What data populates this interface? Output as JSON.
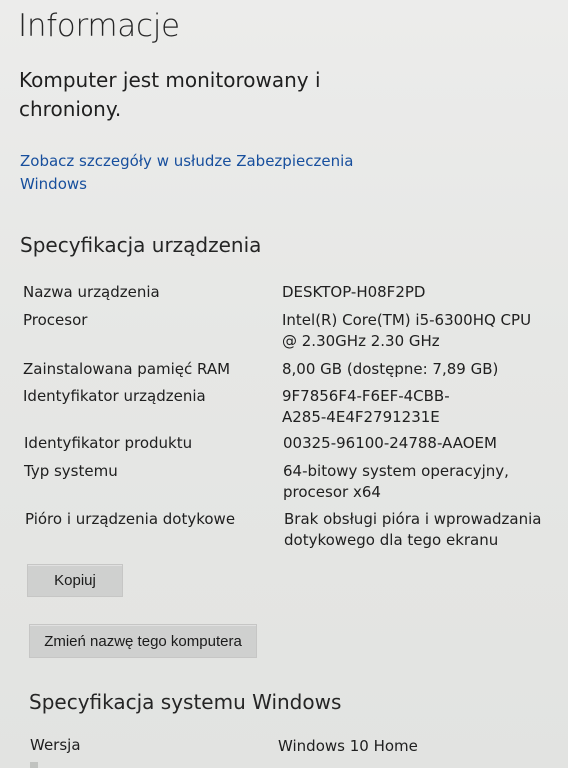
{
  "page": {
    "title": "Informacje"
  },
  "protection": {
    "status_line_1": "Komputer jest monitorowany i",
    "status_line_2": "chroniony.",
    "link_line_1": "Zobacz szczegóły w usłudze Zabezpieczenia",
    "link_line_2": "Windows"
  },
  "device_specs": {
    "title": "Specyfikacja urządzenia",
    "rows": [
      {
        "label": "Nazwa urządzenia",
        "value_line_1": "DESKTOP-H08F2PD",
        "value_line_2": ""
      },
      {
        "label": "Procesor",
        "value_line_1": "Intel(R) Core(TM) i5-6300HQ CPU",
        "value_line_2": "@ 2.30GHz   2.30 GHz"
      },
      {
        "label": "Zainstalowana pamięć RAM",
        "value_line_1": "8,00 GB (dostępne: 7,89 GB)",
        "value_line_2": ""
      },
      {
        "label": "Identyfikator urządzenia",
        "value_line_1": "9F7856F4-F6EF-4CBB-",
        "value_line_2": "A285-4E4F2791231E"
      },
      {
        "label": "Identyfikator produktu",
        "value_line_1": "00325-96100-24788-AAOEM",
        "value_line_2": ""
      },
      {
        "label": "Typ systemu",
        "value_line_1": "64-bitowy system operacyjny,",
        "value_line_2": "procesor x64"
      },
      {
        "label": "Pióro i urządzenia dotykowe",
        "value_line_1": "Brak obsługi pióra i wprowadzania",
        "value_line_2": "dotykowego dla tego ekranu"
      }
    ],
    "copy_button": "Kopiuj",
    "rename_button": "Zmień nazwę tego komputera"
  },
  "windows_specs": {
    "title": "Specyfikacja systemu Windows",
    "version_label": "Wersja",
    "version_value": "Windows 10 Home"
  }
}
